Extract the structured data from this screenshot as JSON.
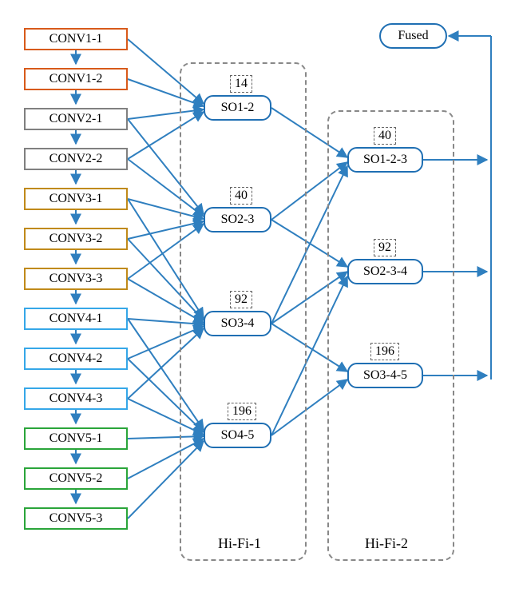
{
  "conv": {
    "c11": "CONV1-1",
    "c12": "CONV1-2",
    "c21": "CONV2-1",
    "c22": "CONV2-2",
    "c31": "CONV3-1",
    "c32": "CONV3-2",
    "c33": "CONV3-3",
    "c41": "CONV4-1",
    "c42": "CONV4-2",
    "c43": "CONV4-3",
    "c51": "CONV5-1",
    "c52": "CONV5-2",
    "c53": "CONV5-3"
  },
  "hifi1": {
    "so12": "SO1-2",
    "so23": "SO2-3",
    "so34": "SO3-4",
    "so45": "SO4-5",
    "n12": "14",
    "n23": "40",
    "n34": "92",
    "n45": "196",
    "label": "Hi-Fi-1"
  },
  "hifi2": {
    "so123": "SO1-2-3",
    "so234": "SO2-3-4",
    "so345": "SO3-4-5",
    "n123": "40",
    "n234": "92",
    "n345": "196",
    "label": "Hi-Fi-2"
  },
  "fused": "Fused",
  "caption": "",
  "chart_data": {
    "type": "diagram",
    "backbone_layers": [
      {
        "group": 1,
        "color": "#d85a1a",
        "layers": [
          "CONV1-1",
          "CONV1-2"
        ]
      },
      {
        "group": 2,
        "color": "#808080",
        "layers": [
          "CONV2-1",
          "CONV2-2"
        ]
      },
      {
        "group": 3,
        "color": "#c08a1a",
        "layers": [
          "CONV3-1",
          "CONV3-2",
          "CONV3-3"
        ]
      },
      {
        "group": 4,
        "color": "#35a7e8",
        "layers": [
          "CONV4-1",
          "CONV4-2",
          "CONV4-3"
        ]
      },
      {
        "group": 5,
        "color": "#2aa53a",
        "layers": [
          "CONV5-1",
          "CONV5-2",
          "CONV5-3"
        ]
      }
    ],
    "hifi1_nodes": [
      {
        "id": "SO1-2",
        "value": 14,
        "inputs": [
          "CONV1-1",
          "CONV1-2",
          "CONV2-1",
          "CONV2-2"
        ]
      },
      {
        "id": "SO2-3",
        "value": 40,
        "inputs": [
          "CONV2-1",
          "CONV2-2",
          "CONV3-1",
          "CONV3-2",
          "CONV3-3"
        ]
      },
      {
        "id": "SO3-4",
        "value": 92,
        "inputs": [
          "CONV3-1",
          "CONV3-2",
          "CONV3-3",
          "CONV4-1",
          "CONV4-2",
          "CONV4-3"
        ]
      },
      {
        "id": "SO4-5",
        "value": 196,
        "inputs": [
          "CONV4-1",
          "CONV4-2",
          "CONV4-3",
          "CONV5-1",
          "CONV5-2",
          "CONV5-3"
        ]
      }
    ],
    "hifi2_nodes": [
      {
        "id": "SO1-2-3",
        "value": 40,
        "inputs": [
          "SO1-2",
          "SO2-3",
          "SO3-4"
        ]
      },
      {
        "id": "SO2-3-4",
        "value": 92,
        "inputs": [
          "SO2-3",
          "SO3-4",
          "SO4-5"
        ]
      },
      {
        "id": "SO3-4-5",
        "value": 196,
        "inputs": [
          "SO3-4",
          "SO4-5"
        ]
      }
    ],
    "fused_inputs": [
      "SO1-2-3",
      "SO2-3-4",
      "SO3-4-5"
    ]
  }
}
